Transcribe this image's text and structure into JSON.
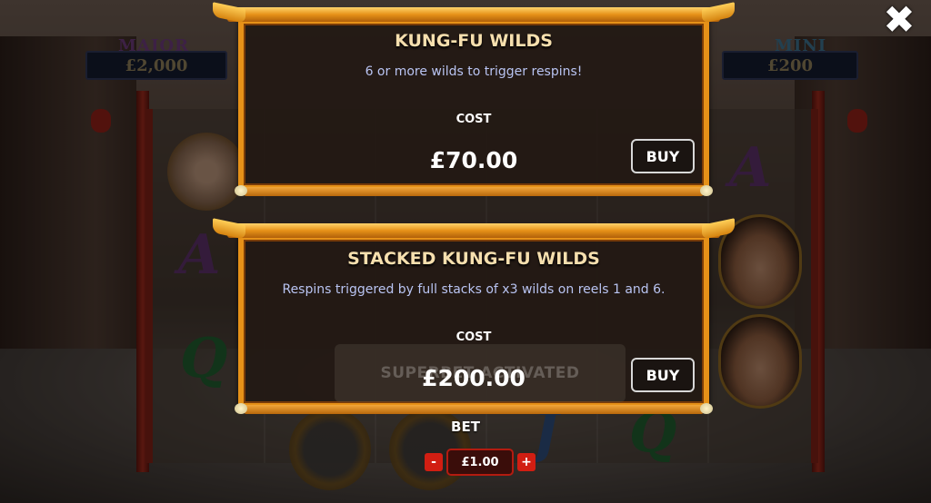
{
  "jackpots": {
    "major": {
      "label": "MAJOR",
      "value": "£2,000"
    },
    "mini": {
      "label": "MINI",
      "value": "£200"
    }
  },
  "close_glyph": "✖",
  "feature_panels": [
    {
      "title": "KUNG-FU WILDS",
      "description": "6 or more wilds to trigger respins!",
      "cost_label": "COST",
      "price": "£70.00",
      "buy_label": "BUY"
    },
    {
      "title": "STACKED KUNG-FU WILDS",
      "description": "Respins triggered by full stacks of x3 wilds on reels 1 and 6.",
      "cost_label": "COST",
      "price": "£200.00",
      "buy_label": "BUY",
      "background_banner": "SUPERBET ACTIVATED"
    }
  ],
  "bet": {
    "label": "BET",
    "value": "£1.00",
    "minus": "-",
    "plus": "+"
  },
  "colors": {
    "panel_border": "#e69118",
    "panel_bg": "#231914",
    "title_text": "#f6dfae",
    "description_text": "#b9c4f2",
    "bet_button": "#d11e12"
  }
}
